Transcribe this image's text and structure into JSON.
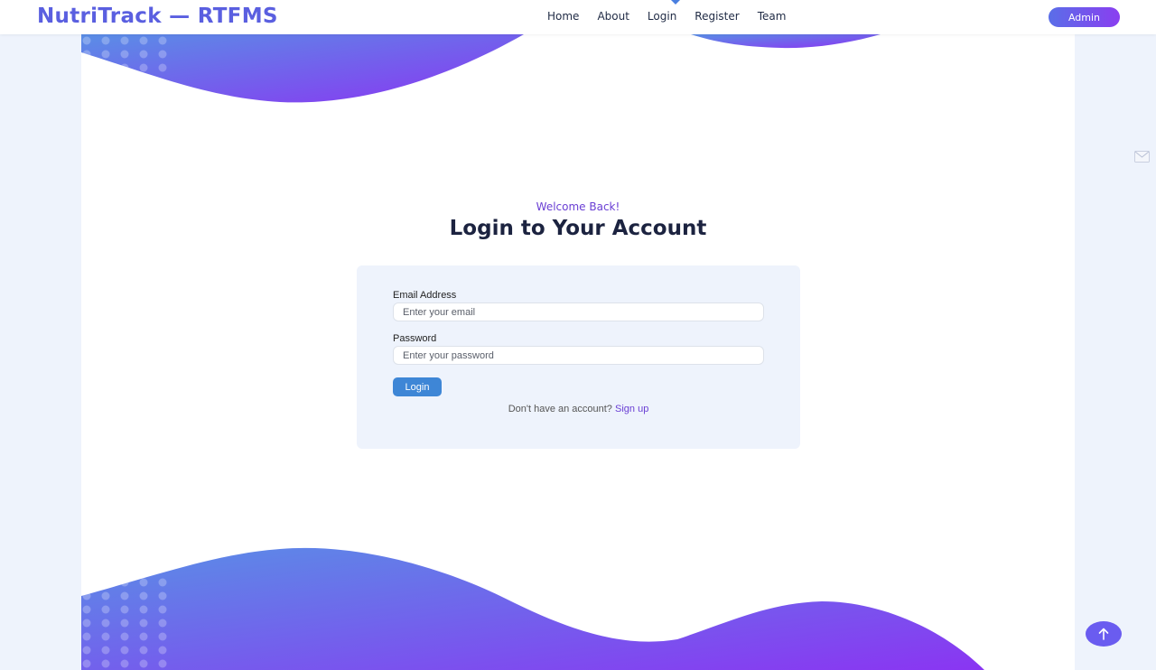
{
  "header": {
    "brand": "NutriTrack — RTFMS",
    "nav": [
      "Home",
      "About",
      "Login",
      "Register",
      "Team"
    ],
    "active_nav": "Login",
    "admin_label": "Admin"
  },
  "hero": {
    "subtitle": "Welcome Back!",
    "title": "Login to Your Account"
  },
  "form": {
    "email_label": "Email Address",
    "email_placeholder": "Enter your email",
    "password_label": "Password",
    "password_placeholder": "Enter your password",
    "submit_label": "Login",
    "signup_prompt": "Don't have an account?",
    "signup_link": "Sign up"
  },
  "icons": {
    "floating": "mail-icon",
    "scroll_top": "arrow-up-icon"
  },
  "colors": {
    "brand": "#5a5fe0",
    "accent_gradient_start": "#5a8ee6",
    "accent_gradient_end": "#8a35f2",
    "button": "#3e86d6",
    "link": "#6a3fd4"
  }
}
